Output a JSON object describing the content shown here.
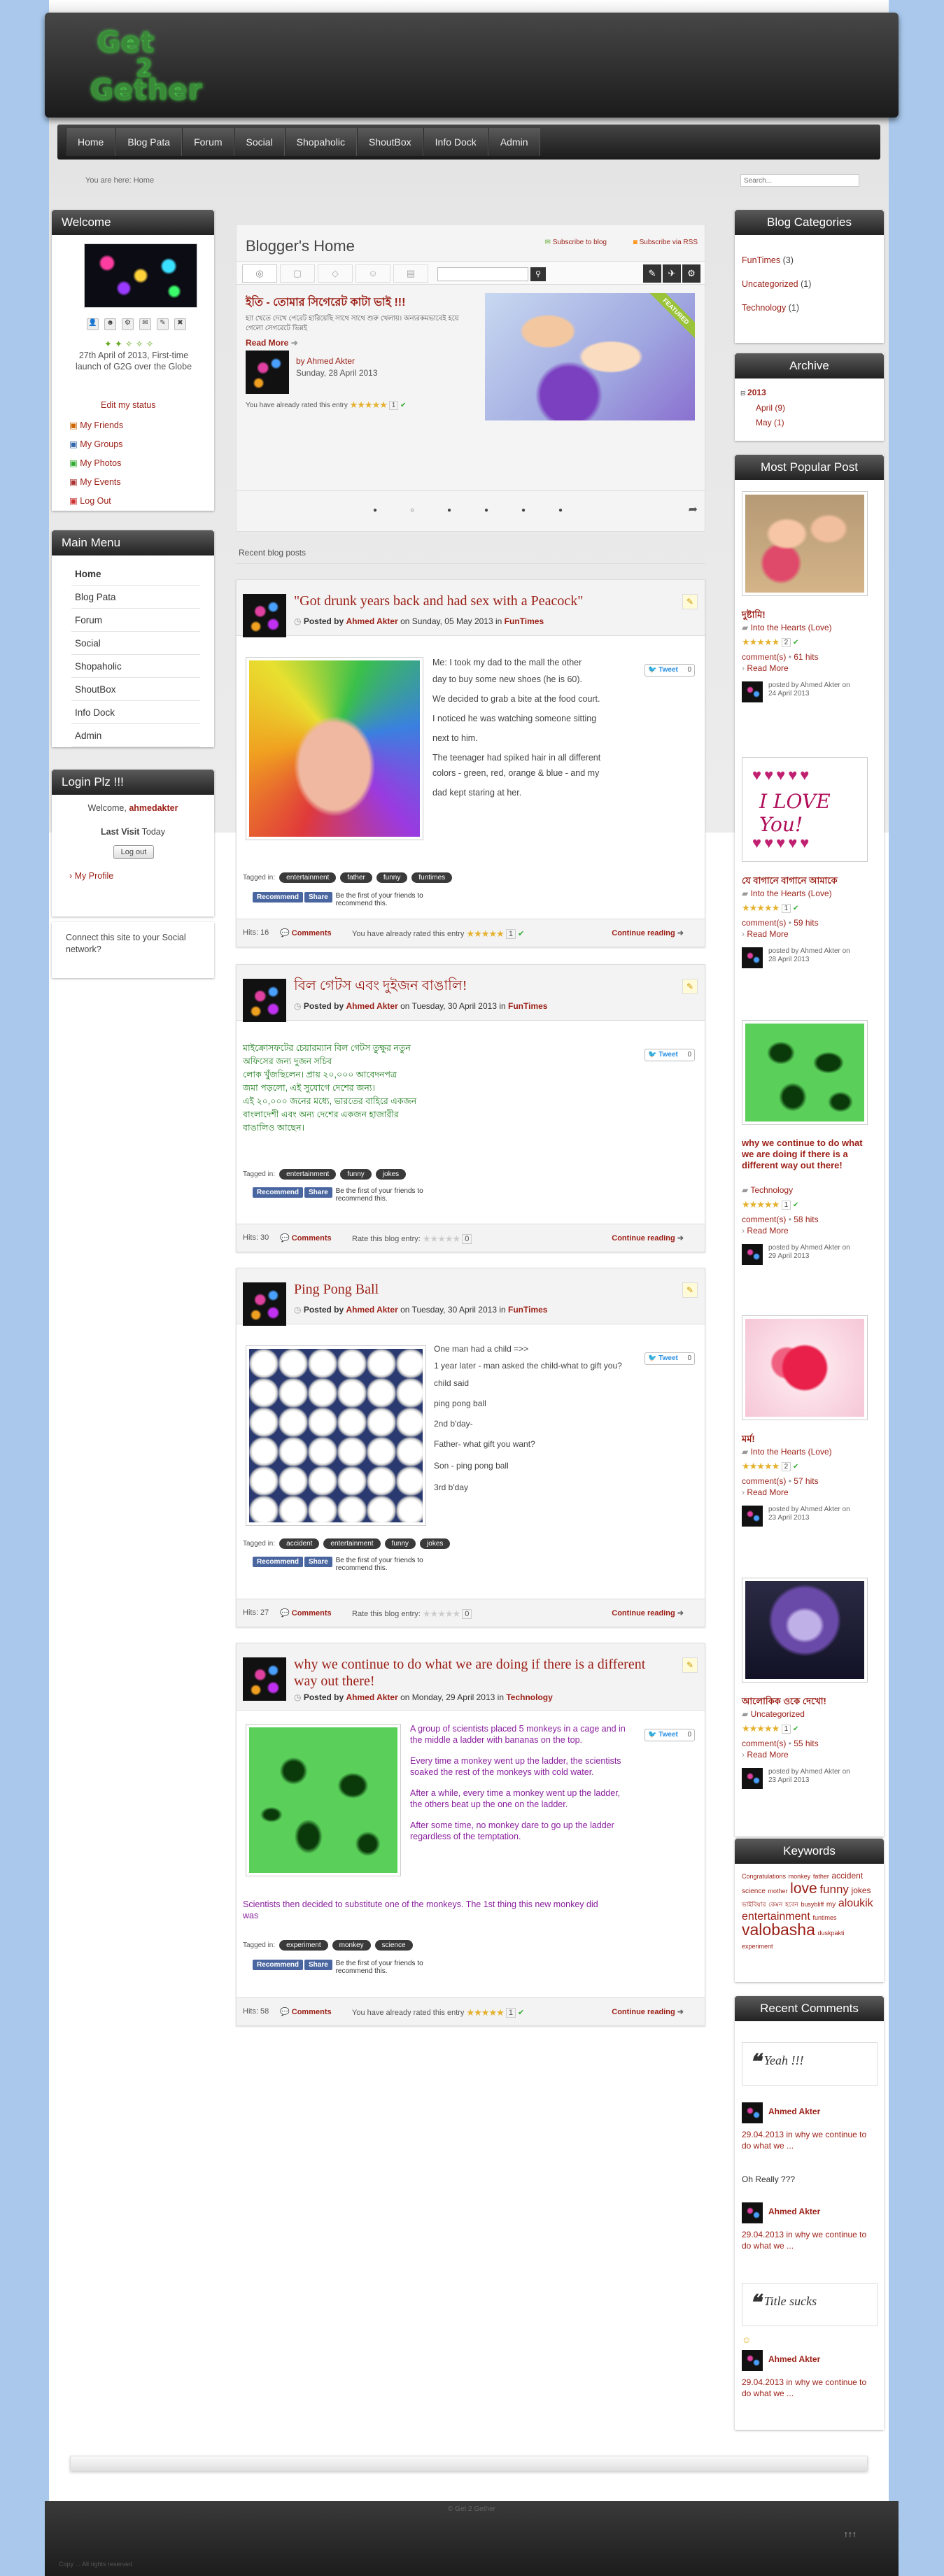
{
  "site": {
    "logo_lines": [
      "Get",
      "2",
      "Gether"
    ]
  },
  "nav": {
    "items": [
      "Home",
      "Blog Pata",
      "Forum",
      "Social",
      "Shopaholic",
      "ShoutBox",
      "Info Dock",
      "Admin"
    ]
  },
  "breadcrumb": {
    "label": "You are here:",
    "current": "Home",
    "search_placeholder": "Search..."
  },
  "welcome": {
    "title": "Welcome",
    "caption": "27th April of 2013, First-time launch of G2G over the Globe",
    "edit_status": "Edit my status",
    "links": [
      "My Friends",
      "My Groups",
      "My Photos",
      "My Events",
      "Log Out"
    ]
  },
  "main_menu": {
    "title": "Main Menu",
    "items": [
      "Home",
      "Blog Pata",
      "Forum",
      "Social",
      "Shopaholic",
      "ShoutBox",
      "Info Dock",
      "Admin"
    ]
  },
  "login": {
    "title": "Login Plz !!!",
    "welcome_label": "Welcome,",
    "user": "ahmedakter",
    "last_visit_label": "Last Visit",
    "last_visit_value": "Today",
    "logout": "Log out",
    "profile": "My Profile"
  },
  "connect": {
    "text": "Connect this site to your Social network?"
  },
  "blog_home": {
    "title": "Blogger's Home",
    "subscribe_blog": "Subscribe to blog",
    "subscribe_rss": "Subscribe via RSS",
    "featured_title": "ইতি - তোমার সিগেরেট কাটা ভাই !!!",
    "featured_excerpt": "হ্যা খেতে দেখে পেরেট হারিয়েছি সাথে সাথে শুরু খেলায়। অন্যরকমভাবেই হয়ে গেলো সেগরেটে ভিন্নই",
    "read_more": "Read More",
    "by": "by Ahmed Akter",
    "date": "Sunday, 28 April 2013",
    "rated_text": "You have already rated this entry",
    "rating_count": "1",
    "featured_badge": "FEATURED",
    "recent_label": "Recent blog posts"
  },
  "posts": [
    {
      "title": "\"Got drunk years back and had sex with a Peacock\"",
      "posted_by": "Posted by",
      "author": "Ahmed Akter",
      "on": "on Sunday, 05 May 2013 in",
      "category": "FunTimes",
      "tweet": "Tweet",
      "tweet_count": "0",
      "paragraphs": [
        "Me: I took my dad to the mall the other",
        "day to buy some new shoes (he is 60).",
        "We decided to grab a bite at the food court.",
        "I noticed he was watching someone sitting",
        "next to him.",
        "The teenager had spiked hair in all different",
        "colors - green, red, orange & blue - and my",
        "dad kept staring at her."
      ],
      "tagged": "Tagged in:",
      "tags": [
        "entertainment",
        "father",
        "funny",
        "funtimes"
      ],
      "fb_recommend": "Recommend",
      "fb_share": "Share",
      "fb_text": "Be the first of your friends to recommend this.",
      "hits": "Hits: 16",
      "comments": "Comments",
      "rate_text": "You have already rated this entry",
      "rate_count": "1",
      "continue": "Continue reading"
    },
    {
      "title": "বিল গেটস এবং দুইজন বাঙালি!",
      "posted_by": "Posted by",
      "author": "Ahmed Akter",
      "on": "on Tuesday, 30 April 2013 in",
      "category": "FunTimes",
      "tweet": "Tweet",
      "tweet_count": "0",
      "paragraphs": [
        "মাইক্রোসফটের চেয়ারম্যান বিল গেটস তুক্ষুর নতুন",
        "অফিসের জন্য দুজন সচিব",
        "লোক খুঁজছিলেন। প্রায় ২০,০০০ আবেদনপত্র",
        "জমা পড়লো, এই সুযোগে দেশের জন্য।",
        "এই ২০,০০০ জনের মধ্যে, ভারতের বাহিরে একজন",
        "বাংলাদেশী এবং অন্য দেশের একজন হাজারীর",
        "বাঙালিও আছেন।"
      ],
      "tagged": "Tagged in:",
      "tags": [
        "entertainment",
        "funny",
        "jokes"
      ],
      "fb_recommend": "Recommend",
      "fb_share": "Share",
      "fb_text": "Be the first of your friends to recommend this.",
      "hits": "Hits: 30",
      "comments": "Comments",
      "rate_text": "Rate this blog entry:",
      "rate_count": "0",
      "continue": "Continue reading"
    },
    {
      "title": "Ping Pong Ball",
      "posted_by": "Posted by",
      "author": "Ahmed Akter",
      "on": "on Tuesday, 30 April 2013 in",
      "category": "FunTimes",
      "tweet": "Tweet",
      "tweet_count": "0",
      "paragraphs": [
        "One man had a child =>>",
        "1 year later - man asked the child-what to gift you?",
        "child said",
        "ping pong ball",
        "2nd b'day-",
        "Father- what gift you want?",
        "Son - ping pong ball",
        "3rd b'day"
      ],
      "tagged": "Tagged in:",
      "tags": [
        "accident",
        "entertainment",
        "funny",
        "jokes"
      ],
      "fb_recommend": "Recommend",
      "fb_share": "Share",
      "fb_text": "Be the first of your friends to recommend this.",
      "hits": "Hits: 27",
      "comments": "Comments",
      "rate_text": "Rate this blog entry:",
      "rate_count": "0",
      "continue": "Continue reading"
    },
    {
      "title": "why we continue to do what we are doing if there is a different way out there!",
      "posted_by": "Posted by",
      "author": "Ahmed Akter",
      "on": "on Monday, 29 April 2013 in",
      "category": "Technology",
      "tweet": "Tweet",
      "tweet_count": "0",
      "paragraphs": [
        "A group of scientists placed 5 monkeys in a cage and in the middle a ladder with bananas on the top.",
        "Every time a monkey went up the ladder, the scientists soaked the rest of the monkeys with cold water.",
        "After a while, every time a monkey went up the ladder, the others beat up the one on the ladder.",
        "After some time, no monkey dare to go up the ladder regardless of the temptation."
      ],
      "extra": "Scientists then decided to substitute one of the monkeys. The 1st thing this new monkey did was",
      "tagged": "Tagged in:",
      "tags": [
        "experiment",
        "monkey",
        "science"
      ],
      "fb_recommend": "Recommend",
      "fb_share": "Share",
      "fb_text": "Be the first of your friends to recommend this.",
      "hits": "Hits: 58",
      "comments": "Comments",
      "rate_text": "You have already rated this entry",
      "rate_count": "1",
      "continue": "Continue reading"
    }
  ],
  "categories": {
    "title": "Blog Categories",
    "items": [
      {
        "name": "FunTimes",
        "count": "(3)"
      },
      {
        "name": "Uncategorized",
        "count": "(1)"
      },
      {
        "name": "Technology",
        "count": "(1)"
      }
    ]
  },
  "archive": {
    "title": "Archive",
    "year": "2013",
    "months": [
      {
        "name": "April",
        "count": "(9)"
      },
      {
        "name": "May",
        "count": "(1)"
      }
    ]
  },
  "popular": {
    "title": "Most Popular Post",
    "items": [
      {
        "title": "দুষ্টামি!",
        "cat": "Into the Hearts (Love)",
        "rate": "2",
        "comments": "comment(s)",
        "hits": "61 hits",
        "read": "Read More",
        "by": "posted by Ahmed Akter on 24 April 2013"
      },
      {
        "title": "যে বাগানে বাগানে আমাকে",
        "cat": "Into the Hearts (Love)",
        "rate": "1",
        "comments": "comment(s)",
        "hits": "59 hits",
        "read": "Read More",
        "by": "posted by Ahmed Akter on 28 April 2013"
      },
      {
        "title": "why we continue to do what we are doing if there is a different way out there!",
        "cat": "Technology",
        "rate": "1",
        "comments": "comment(s)",
        "hits": "58 hits",
        "read": "Read More",
        "by": "posted by Ahmed Akter on 29 April 2013"
      },
      {
        "title": "মর্ম!",
        "cat": "Into the Hearts (Love)",
        "rate": "2",
        "comments": "comment(s)",
        "hits": "57 hits",
        "read": "Read More",
        "by": "posted by Ahmed Akter on 23 April 2013"
      },
      {
        "title": "আলোকিক ওকে দেখো!",
        "cat": "Uncategorized",
        "rate": "1",
        "comments": "comment(s)",
        "hits": "55 hits",
        "read": "Read More",
        "by": "posted by Ahmed Akter on 23 April 2013"
      }
    ]
  },
  "keywords": {
    "title": "Keywords",
    "words": [
      "Congratulations",
      "monkey",
      "father",
      "accident",
      "science",
      "mother",
      "love",
      "funny",
      "jokes",
      "ভাইবিয়ার",
      "কেমন",
      "হবেন",
      "busybliff",
      "my",
      "aloukik",
      "entertainment",
      "funtimes",
      "valobasha",
      "duskpakti",
      "experiment"
    ]
  },
  "recent_comments": {
    "title": "Recent Comments",
    "items": [
      {
        "quote": "Yeah !!!",
        "author": "Ahmed Akter",
        "date": "29.04.2013 in",
        "post": "why we continue to do what we ..."
      },
      {
        "quote": "Oh Really ???",
        "author": "Ahmed Akter",
        "date": "29.04.2013 in",
        "post": "why we continue to do what we ..."
      },
      {
        "quote": "Title sucks",
        "author": "Ahmed Akter",
        "date": "29.04.2013 in",
        "post": "why we continue to do what we ..."
      }
    ]
  },
  "footer": {
    "text": "© Get 2 Gether",
    "right": "↑↑↑",
    "bottom": "Copy ... All rights reserved"
  }
}
